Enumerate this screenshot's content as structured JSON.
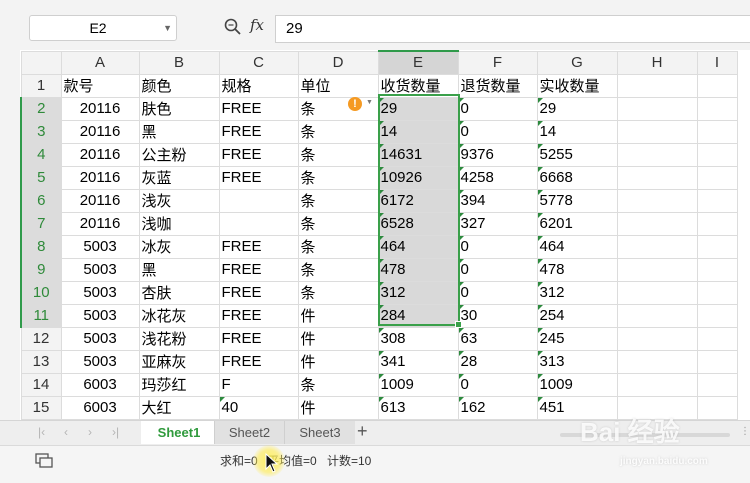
{
  "formula_bar": {
    "name_box": "E2",
    "fx_label": "fx",
    "formula_value": "29"
  },
  "columns": [
    "",
    "A",
    "B",
    "C",
    "D",
    "E",
    "F",
    "G",
    "H",
    "I"
  ],
  "rows": [
    {
      "num": "1",
      "cells": [
        "款号",
        "颜色",
        "规格",
        "单位",
        "收货数量",
        "退货数量",
        "实收数量",
        "",
        ""
      ]
    },
    {
      "num": "2",
      "cells": [
        "20116",
        "肤色",
        "FREE",
        "条",
        "29",
        "0",
        "29",
        "",
        ""
      ]
    },
    {
      "num": "3",
      "cells": [
        "20116",
        "黑",
        "FREE",
        "条",
        "14",
        "0",
        "14",
        "",
        ""
      ]
    },
    {
      "num": "4",
      "cells": [
        "20116",
        "公主粉",
        "FREE",
        "条",
        "14631",
        "9376",
        "5255",
        "",
        ""
      ]
    },
    {
      "num": "5",
      "cells": [
        "20116",
        "灰蓝",
        "FREE",
        "条",
        "10926",
        "4258",
        "6668",
        "",
        ""
      ]
    },
    {
      "num": "6",
      "cells": [
        "20116",
        "浅灰",
        "",
        "条",
        "6172",
        "394",
        "5778",
        "",
        ""
      ]
    },
    {
      "num": "7",
      "cells": [
        "20116",
        "浅咖",
        "",
        "条",
        "6528",
        "327",
        "6201",
        "",
        ""
      ]
    },
    {
      "num": "8",
      "cells": [
        "5003",
        "冰灰",
        "FREE",
        "条",
        "464",
        "0",
        "464",
        "",
        ""
      ]
    },
    {
      "num": "9",
      "cells": [
        "5003",
        "黑",
        "FREE",
        "条",
        "478",
        "0",
        "478",
        "",
        ""
      ]
    },
    {
      "num": "10",
      "cells": [
        "5003",
        "杏肤",
        "FREE",
        "条",
        "312",
        "0",
        "312",
        "",
        ""
      ]
    },
    {
      "num": "11",
      "cells": [
        "5003",
        "冰花灰",
        "FREE",
        "件",
        "284",
        "30",
        "254",
        "",
        ""
      ]
    },
    {
      "num": "12",
      "cells": [
        "5003",
        "浅花粉",
        "FREE",
        "件",
        "308",
        "63",
        "245",
        "",
        ""
      ]
    },
    {
      "num": "13",
      "cells": [
        "5003",
        "亚麻灰",
        "FREE",
        "件",
        "341",
        "28",
        "313",
        "",
        ""
      ]
    },
    {
      "num": "14",
      "cells": [
        "6003",
        "玛莎红",
        "F",
        "条",
        "1009",
        "0",
        "1009",
        "",
        ""
      ]
    },
    {
      "num": "15",
      "cells": [
        "6003",
        "大红",
        "40",
        "件",
        "613",
        "162",
        "451",
        "",
        ""
      ]
    }
  ],
  "sheet_tabs": [
    "Sheet1",
    "Sheet2",
    "Sheet3"
  ],
  "add_tab": "+",
  "status": {
    "sum": "求和=0",
    "average": "平均值=0",
    "count": "计数=10"
  },
  "watermark": {
    "main": "Bai 经验",
    "sub": "jingyan.baidu.com"
  },
  "colors": {
    "accent": "#2f9a3c",
    "selection": "#d9d9d9",
    "warning": "#f59a23"
  },
  "icons": [
    "zoom-formula-icon",
    "fx-icon",
    "warning-icon",
    "chevron-down-icon",
    "status-layout-icon",
    "cursor-icon"
  ]
}
